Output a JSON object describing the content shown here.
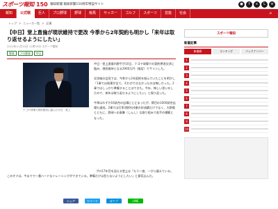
{
  "header": {
    "logo_text": "スポーツ報知",
    "logo_num": "150",
    "tagline": "報知新聞 報知新聞150周年特設サイト",
    "icons": [
      "user-icon",
      "facebook-icon",
      "x-icon",
      "line-icon",
      "menu-icon"
    ]
  },
  "nav": {
    "items": [
      {
        "label": "報知"
      },
      {
        "label": "公式戦"
      },
      {
        "label": "巨人"
      },
      {
        "label": "プロ野球"
      },
      {
        "label": "野球"
      },
      {
        "label": "競馬"
      },
      {
        "label": "サッカー"
      },
      {
        "label": "ゴルフ"
      },
      {
        "label": "スポーツ"
      },
      {
        "label": "芸能"
      },
      {
        "label": "社会"
      }
    ]
  },
  "breadcrumb": [
    "トップ",
    "ニュース一覧",
    "記事"
  ],
  "article": {
    "title": "【中日】堂上直倫が現状維持で更改 今季から2年契約も明かし「来年は取り返せるようにしたい」",
    "meta": "2022年11月10日 11時33分 スポーツ報知",
    "tags": [
      "野球",
      "プロ野球",
      "中日"
    ],
    "caption": "ナゴヤ球場で契約更改に臨んだ中日・堂上",
    "paragraphs": [
      "中日・堂上直倫内野手が10日、ナゴヤ球場での契約更改交渉に臨み、現状維持となる2900万円（推定）でサインした。",
      "交渉後の会見では、今季から2年契約を結んでいたことを明かし「1軍では結果が全て。それができなかったのは悔しかった。2軍ではしっかり準備することはできた。今年、悔しい思いをしたので、来年は取り返せるようにしたい」と振り返った。",
      "今季はわずか16試合の出場にとどまったが、節目の1000試合出場も達成。2軍では打率3割9分4厘の好成績だけでなく、大野陽とともに、野球への真摯（しんし）な取り組みで若手の模範となった。"
    ],
    "last_paragraph": "プロ17年目を迎える堂上は「もう一度、一から鍛えている。このオフは、今までで一番ハードなトレーニングができている。準備だけは怠らないようにしたい」と意気込んだ。"
  },
  "share": [
    {
      "label": "シェア",
      "color": "#3b5998"
    },
    {
      "label": "ツイート",
      "color": "#1da1f2"
    },
    {
      "label": "はてブ",
      "color": "#008fde"
    },
    {
      "label": "LINE",
      "color": "#00b900"
    }
  ],
  "sidebar": {
    "box_label": "スポーツ報知",
    "heading": "新着記事",
    "tabs": [
      "新着順",
      "ランキング",
      "バックナンバー"
    ],
    "ranks": [
      "1",
      "2",
      "3",
      "4",
      "5",
      "6",
      "7",
      "8",
      "9",
      "10"
    ],
    "ad_label": ""
  },
  "colors": {
    "accent": "#c8141e",
    "tag": "#2c7a2c"
  }
}
